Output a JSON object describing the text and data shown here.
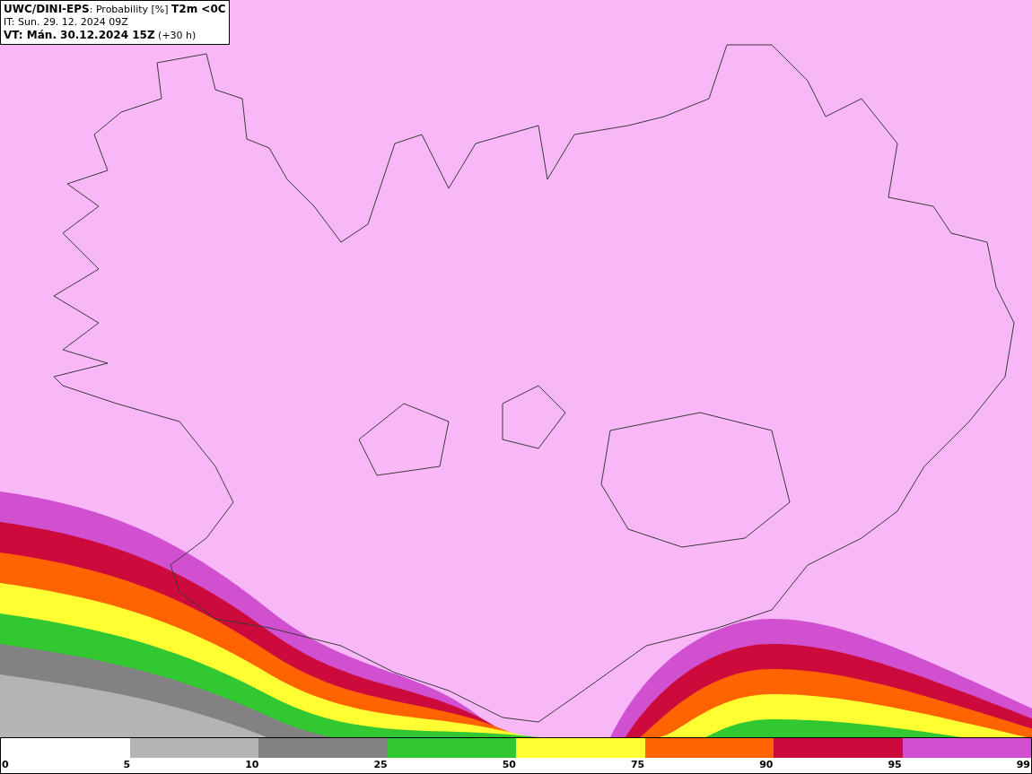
{
  "header": {
    "lines": [
      "**UWC/DINI-EPS**: Probability [%] **T2m <0C**",
      "IT: Sun. 29. 12. 2024 09Z",
      "**VT: Mán. 30.12.2024 15Z** (+30 h)"
    ]
  },
  "legend": {
    "segments": [
      {
        "color": "#b4b4b4"
      },
      {
        "color": "#828282"
      },
      {
        "color": "#32c832"
      },
      {
        "color": "#ffff32"
      },
      {
        "color": "#ff6400"
      },
      {
        "color": "#cd0a3c"
      },
      {
        "color": "#d050d0"
      }
    ],
    "ticks": [
      "0",
      "5",
      "10",
      "25",
      "50",
      "75",
      "90",
      "95",
      "99"
    ]
  }
}
